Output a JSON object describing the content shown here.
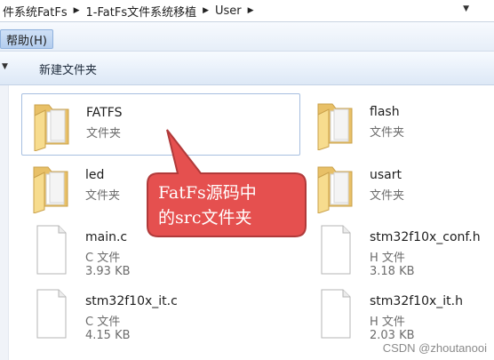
{
  "address": {
    "crumbs": [
      "件系统FatFs",
      "1-FatFs文件系统移植",
      "User"
    ]
  },
  "menu": {
    "help_label": "帮助(H)"
  },
  "toolbar": {
    "new_folder_label": "新建文件夹"
  },
  "files": [
    {
      "name": "FATFS",
      "type": "文件夹",
      "size": "",
      "kind": "folder"
    },
    {
      "name": "flash",
      "type": "文件夹",
      "size": "",
      "kind": "folder"
    },
    {
      "name": "led",
      "type": "文件夹",
      "size": "",
      "kind": "folder"
    },
    {
      "name": "usart",
      "type": "文件夹",
      "size": "",
      "kind": "folder"
    },
    {
      "name": "main.c",
      "type": "C 文件",
      "size": "3.93 KB",
      "kind": "file"
    },
    {
      "name": "stm32f10x_conf.h",
      "type": "H 文件",
      "size": "3.18 KB",
      "kind": "file"
    },
    {
      "name": "stm32f10x_it.c",
      "type": "C 文件",
      "size": "4.15 KB",
      "kind": "file"
    },
    {
      "name": "stm32f10x_it.h",
      "type": "H 文件",
      "size": "2.03 KB",
      "kind": "file"
    }
  ],
  "callout": {
    "text": "FatFs源码中\n的src文件夹",
    "fill_color": "#e5504f",
    "border_color": "#b03a3a"
  },
  "watermark": "CSDN @zhoutanooi",
  "colors": {
    "selection_border": "#a7bfe0",
    "folder_back": "#e8c067",
    "folder_front": "#f7dc8e"
  }
}
